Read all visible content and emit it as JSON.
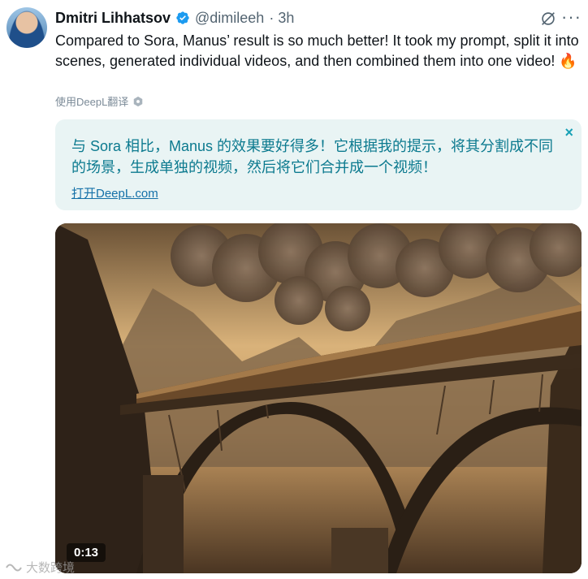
{
  "author": {
    "name": "Dmitri Lihhatsov",
    "handle": "@dimileeh",
    "time": "· 3h",
    "verified": true
  },
  "tweet": {
    "text": "Compared to Sora, Manus’ result is so much better! It took my prompt, split it into scenes, generated individual videos, and then combined them into one video! 🔥"
  },
  "translation": {
    "link_label": "使用DeepL翻译",
    "text": "与 Sora 相比，Manus 的效果要好得多！它根据我的提示，将其分割成不同的场景，生成单独的视频，然后将它们合并成一个视频！",
    "open_label": "打开DeepL.com",
    "close_symbol": "×"
  },
  "media": {
    "duration": "0:13"
  },
  "watermark": {
    "text": "大数跨境"
  },
  "colors": {
    "accent_teal": "#0c7a8f",
    "verified_blue": "#1d9bf0",
    "translate_bg": "#e9f4f4"
  },
  "icons": [
    "avatar",
    "verified-badge-icon",
    "grok-icon",
    "more-icon",
    "deepl-hex-icon",
    "close-icon"
  ]
}
